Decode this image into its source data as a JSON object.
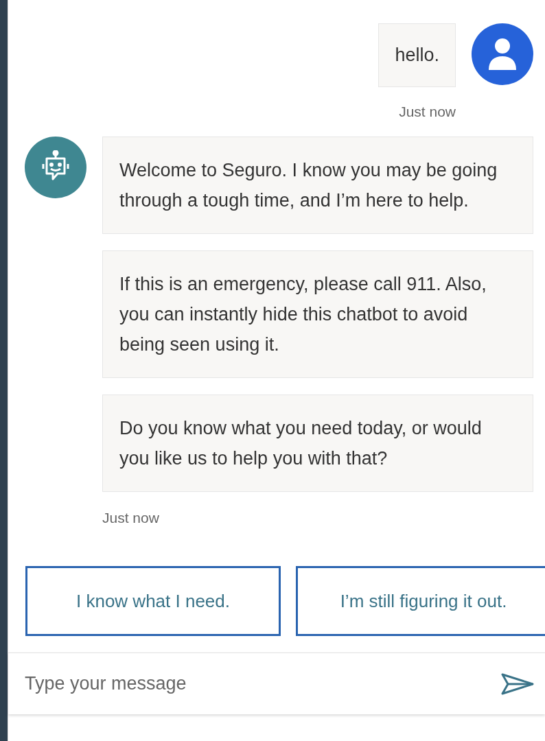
{
  "user_message": {
    "text": "hello.",
    "time": "Just now"
  },
  "bot_messages": [
    "Welcome to Seguro. I know you may be going through a tough time, and I’m here to help.",
    "If this is an emergency, please call 911. Also, you can instantly hide this chatbot to avoid being seen using it.",
    "Do you know what you need today, or would you like us to help you with that?"
  ],
  "bot_time": "Just now",
  "quick_replies": [
    "I know what I need.",
    "I’m still figuring it out."
  ],
  "composer": {
    "placeholder": "Type your message"
  }
}
